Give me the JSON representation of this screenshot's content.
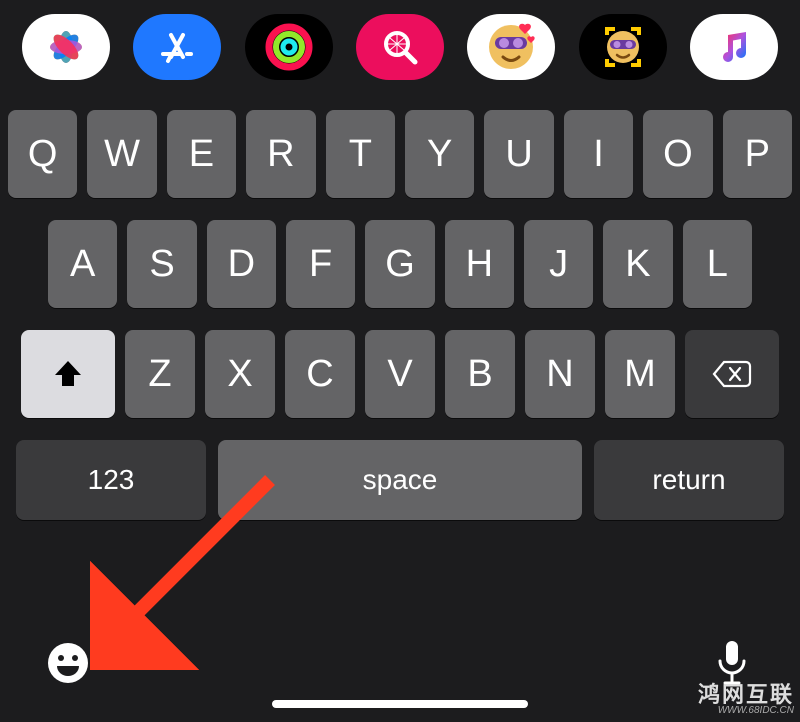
{
  "app_strip": [
    {
      "name": "photos-app-icon"
    },
    {
      "name": "app-store-icon"
    },
    {
      "name": "activity-app-icon"
    },
    {
      "name": "search-app-icon"
    },
    {
      "name": "memoji-hearts-icon"
    },
    {
      "name": "memoji-icon"
    },
    {
      "name": "music-app-icon"
    }
  ],
  "keyboard": {
    "row1": [
      "Q",
      "W",
      "E",
      "R",
      "T",
      "Y",
      "U",
      "I",
      "O",
      "P"
    ],
    "row2": [
      "A",
      "S",
      "D",
      "F",
      "G",
      "H",
      "J",
      "K",
      "L"
    ],
    "row3_letters": [
      "Z",
      "X",
      "C",
      "V",
      "B",
      "N",
      "M"
    ],
    "shift_label": "",
    "backspace_label": "",
    "numbers_label": "123",
    "space_label": "space",
    "return_label": "return"
  },
  "bottom": {
    "emoji_label": "",
    "mic_label": ""
  },
  "annotation": {
    "arrow_color": "#ff3b1f"
  },
  "watermark": {
    "line1": "鸿网互联",
    "line2": "WWW.68IDC.CN"
  }
}
